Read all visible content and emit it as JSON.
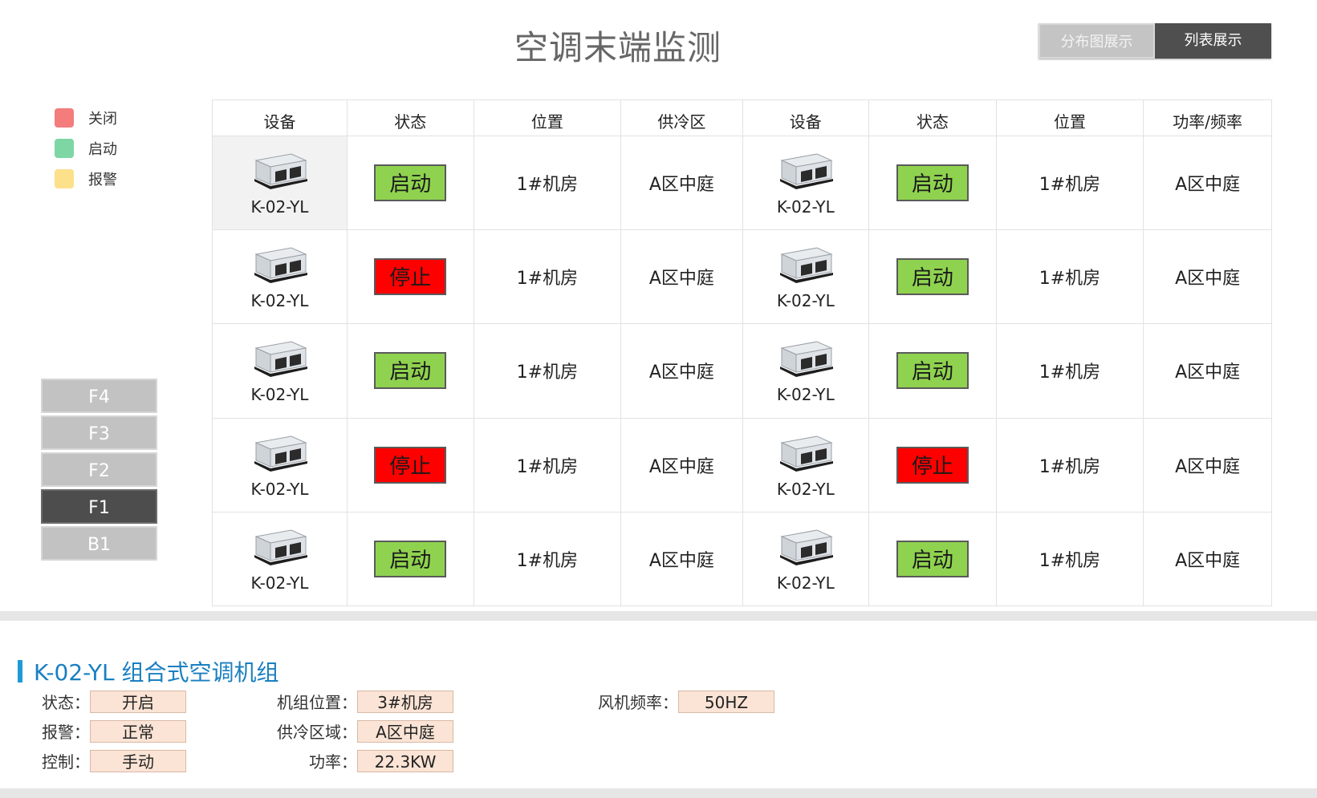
{
  "header": {
    "title": "空调末端监测"
  },
  "view_toggle": {
    "map_label": "分布图展示",
    "list_label": "列表展示"
  },
  "legend": [
    {
      "label": "关闭",
      "color": "#f47c7c"
    },
    {
      "label": "启动",
      "color": "#7dd6a4"
    },
    {
      "label": "报警",
      "color": "#fde08a"
    }
  ],
  "floors": [
    "F4",
    "F3",
    "F2",
    "F1",
    "B1"
  ],
  "active_floor": "F1",
  "table": {
    "headers": [
      "设备",
      "状态",
      "位置",
      "供冷区",
      "设备",
      "状态",
      "位置",
      "功率/频率"
    ],
    "rows": [
      {
        "left": {
          "device": "K-02-YL",
          "status": "启动",
          "location": "1#机房",
          "zone": "A区中庭"
        },
        "right": {
          "device": "K-02-YL",
          "status": "启动",
          "location": "1#机房",
          "zone": "A区中庭"
        }
      },
      {
        "left": {
          "device": "K-02-YL",
          "status": "停止",
          "location": "1#机房",
          "zone": "A区中庭"
        },
        "right": {
          "device": "K-02-YL",
          "status": "启动",
          "location": "1#机房",
          "zone": "A区中庭"
        }
      },
      {
        "left": {
          "device": "K-02-YL",
          "status": "启动",
          "location": "1#机房",
          "zone": "A区中庭"
        },
        "right": {
          "device": "K-02-YL",
          "status": "启动",
          "location": "1#机房",
          "zone": "A区中庭"
        }
      },
      {
        "left": {
          "device": "K-02-YL",
          "status": "停止",
          "location": "1#机房",
          "zone": "A区中庭"
        },
        "right": {
          "device": "K-02-YL",
          "status": "停止",
          "location": "1#机房",
          "zone": "A区中庭"
        }
      },
      {
        "left": {
          "device": "K-02-YL",
          "status": "启动",
          "location": "1#机房",
          "zone": "A区中庭"
        },
        "right": {
          "device": "K-02-YL",
          "status": "启动",
          "location": "1#机房",
          "zone": "A区中庭"
        }
      }
    ]
  },
  "status_colors": {
    "启动": "#8fd24f",
    "停止": "#ff0000"
  },
  "detail": {
    "title": "K-02-YL 组合式空调机组",
    "fields": {
      "status": {
        "label": "状态：",
        "value": "开启"
      },
      "alarm": {
        "label": "报警：",
        "value": "正常"
      },
      "control": {
        "label": "控制：",
        "value": "手动"
      },
      "unit_location": {
        "label": "机组位置：",
        "value": "3#机房"
      },
      "supply_zone": {
        "label": "供冷区域：",
        "value": "A区中庭"
      },
      "power": {
        "label": "功率：",
        "value": "22.3KW"
      },
      "fan_freq": {
        "label": "风机频率：",
        "value": "50HZ"
      }
    }
  }
}
